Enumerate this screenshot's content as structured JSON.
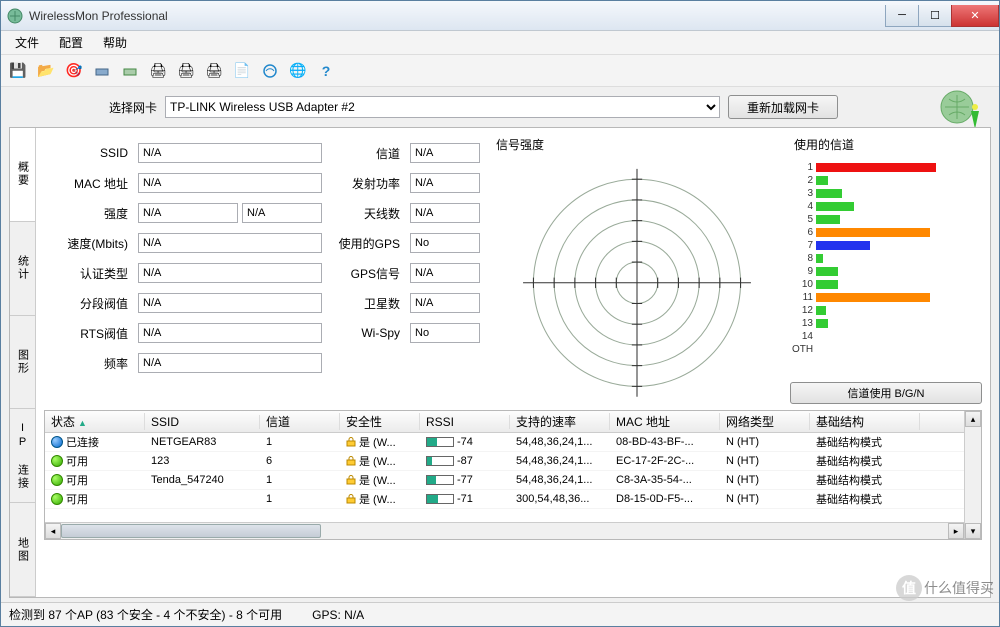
{
  "window": {
    "title": "WirelessMon Professional"
  },
  "menu": {
    "file": "文件",
    "config": "配置",
    "help": "帮助"
  },
  "toolbar_icons": [
    "save",
    "open",
    "target",
    "net1",
    "net2",
    "print1",
    "print2",
    "print3",
    "doc",
    "net3",
    "web",
    "help"
  ],
  "selector": {
    "label": "选择网卡",
    "value": "TP-LINK Wireless USB Adapter #2",
    "reload": "重新加载网卡"
  },
  "side_tabs": {
    "summary": "概要",
    "stats": "统计",
    "graph": "图形",
    "ipconn": "IP 连接",
    "map": "地图"
  },
  "fields": {
    "ssid_lbl": "SSID",
    "ssid": "N/A",
    "mac_lbl": "MAC 地址",
    "mac": "N/A",
    "strength_lbl": "强度",
    "strength1": "N/A",
    "strength2": "N/A",
    "speed_lbl": "速度(Mbits)",
    "speed": "N/A",
    "auth_lbl": "认证类型",
    "auth": "N/A",
    "frag_lbl": "分段阀值",
    "frag": "N/A",
    "rts_lbl": "RTS阀值",
    "rts": "N/A",
    "freq_lbl": "频率",
    "freq": "N/A",
    "channel_lbl": "信道",
    "channel": "N/A",
    "txpower_lbl": "发射功率",
    "txpower": "N/A",
    "antenna_lbl": "天线数",
    "antenna": "N/A",
    "gpsused_lbl": "使用的GPS",
    "gpsused": "No",
    "gpssig_lbl": "GPS信号",
    "gpssig": "N/A",
    "sat_lbl": "卫星数",
    "sat": "N/A",
    "wispy_lbl": "Wi-Spy",
    "wispy": "No"
  },
  "radar": {
    "title": "信号强度"
  },
  "channels": {
    "title": "使用的信道",
    "button": "信道使用 B/G/N",
    "oth": "OTH"
  },
  "chart_data": {
    "type": "bar",
    "title": "使用的信道",
    "categories": [
      "1",
      "2",
      "3",
      "4",
      "5",
      "6",
      "7",
      "8",
      "9",
      "10",
      "11",
      "12",
      "13",
      "14",
      "OTH"
    ],
    "values": [
      100,
      10,
      22,
      32,
      20,
      95,
      45,
      6,
      18,
      18,
      95,
      8,
      10,
      0,
      0
    ],
    "colors": [
      "#e11",
      "#3c3",
      "#3c3",
      "#3c3",
      "#3c3",
      "#f80",
      "#23e",
      "#3c3",
      "#3c3",
      "#3c3",
      "#f80",
      "#3c3",
      "#3c3",
      "#3c3",
      "#3c3"
    ],
    "xlabel": "",
    "ylabel": "",
    "ylim": [
      0,
      100
    ]
  },
  "list": {
    "headers": {
      "status": "状态",
      "ssid": "SSID",
      "channel": "信道",
      "security": "安全性",
      "rssi": "RSSI",
      "rates": "支持的速率",
      "mac": "MAC 地址",
      "nettype": "网络类型",
      "infra": "基础结构"
    },
    "rows": [
      {
        "status_color": "blue",
        "status": "已连接",
        "ssid": "NETGEAR83",
        "channel": "1",
        "security": "是 (W...",
        "rssi": "-74",
        "rssi_pct": 40,
        "rates": "54,48,36,24,1...",
        "mac": "08-BD-43-BF-...",
        "nettype": "N (HT)",
        "infra": "基础结构模式"
      },
      {
        "status_color": "green",
        "status": "可用",
        "ssid": "123",
        "channel": "6",
        "security": "是 (W...",
        "rssi": "-87",
        "rssi_pct": 18,
        "rates": "54,48,36,24,1...",
        "mac": "EC-17-2F-2C-...",
        "nettype": "N (HT)",
        "infra": "基础结构模式"
      },
      {
        "status_color": "green",
        "status": "可用",
        "ssid": "Tenda_547240",
        "channel": "1",
        "security": "是 (W...",
        "rssi": "-77",
        "rssi_pct": 34,
        "rates": "54,48,36,24,1...",
        "mac": "C8-3A-35-54-...",
        "nettype": "N (HT)",
        "infra": "基础结构模式"
      },
      {
        "status_color": "green",
        "status": "可用",
        "ssid": "",
        "channel": "1",
        "security": "是 (W...",
        "rssi": "-71",
        "rssi_pct": 44,
        "rates": "300,54,48,36...",
        "mac": "D8-15-0D-F5-...",
        "nettype": "N (HT)",
        "infra": "基础结构模式"
      }
    ]
  },
  "statusbar": {
    "ap": "检测到 87 个AP (83 个安全 - 4 个不安全) - 8 个可用",
    "gps": "GPS: N/A"
  },
  "watermark": "什么值得买"
}
